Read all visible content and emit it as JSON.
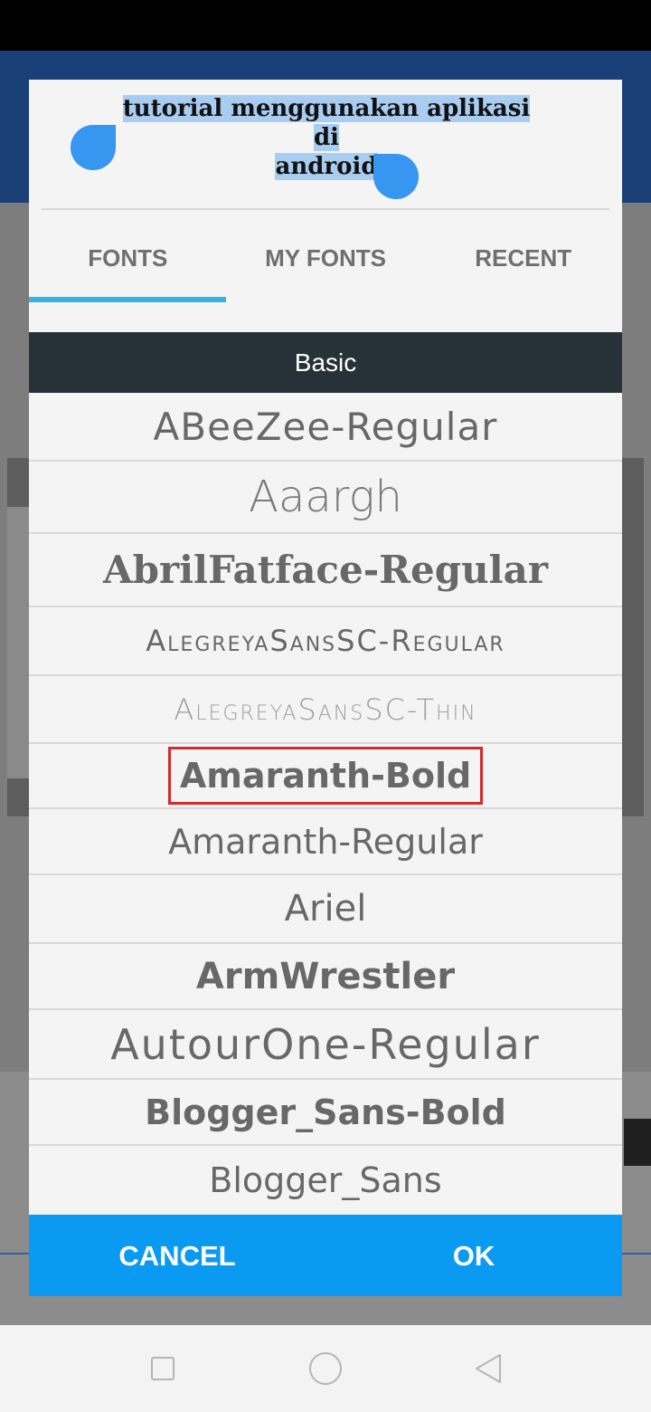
{
  "preview": {
    "text_line1": "tutorial menggunakan aplikasi di",
    "text_line2": "android"
  },
  "tabs": [
    {
      "label": "FONTS",
      "active": true
    },
    {
      "label": "MY FONTS",
      "active": false
    },
    {
      "label": "RECENT",
      "active": false
    }
  ],
  "section_header": "Basic",
  "fonts": [
    "ABeeZee-Regular",
    "Aaargh",
    "AbrilFatface-Regular",
    "AlegreyaSansSC-Regular",
    "AlegreyaSansSC-Thin",
    "Amaranth-Bold",
    "Amaranth-Regular",
    "Ariel",
    "ArmWrestler",
    "AutourOne-Regular",
    "Blogger_Sans-Bold",
    "Blogger_Sans"
  ],
  "highlighted_font_index": 5,
  "buttons": {
    "cancel": "CANCEL",
    "ok": "OK"
  },
  "colors": {
    "accent": "#0a9af2",
    "tab_indicator": "#39b2de",
    "section_header_bg": "#263238",
    "highlight_border": "#d42b2b"
  },
  "icons": [
    "square-icon",
    "circle-icon",
    "back-triangle-icon"
  ]
}
